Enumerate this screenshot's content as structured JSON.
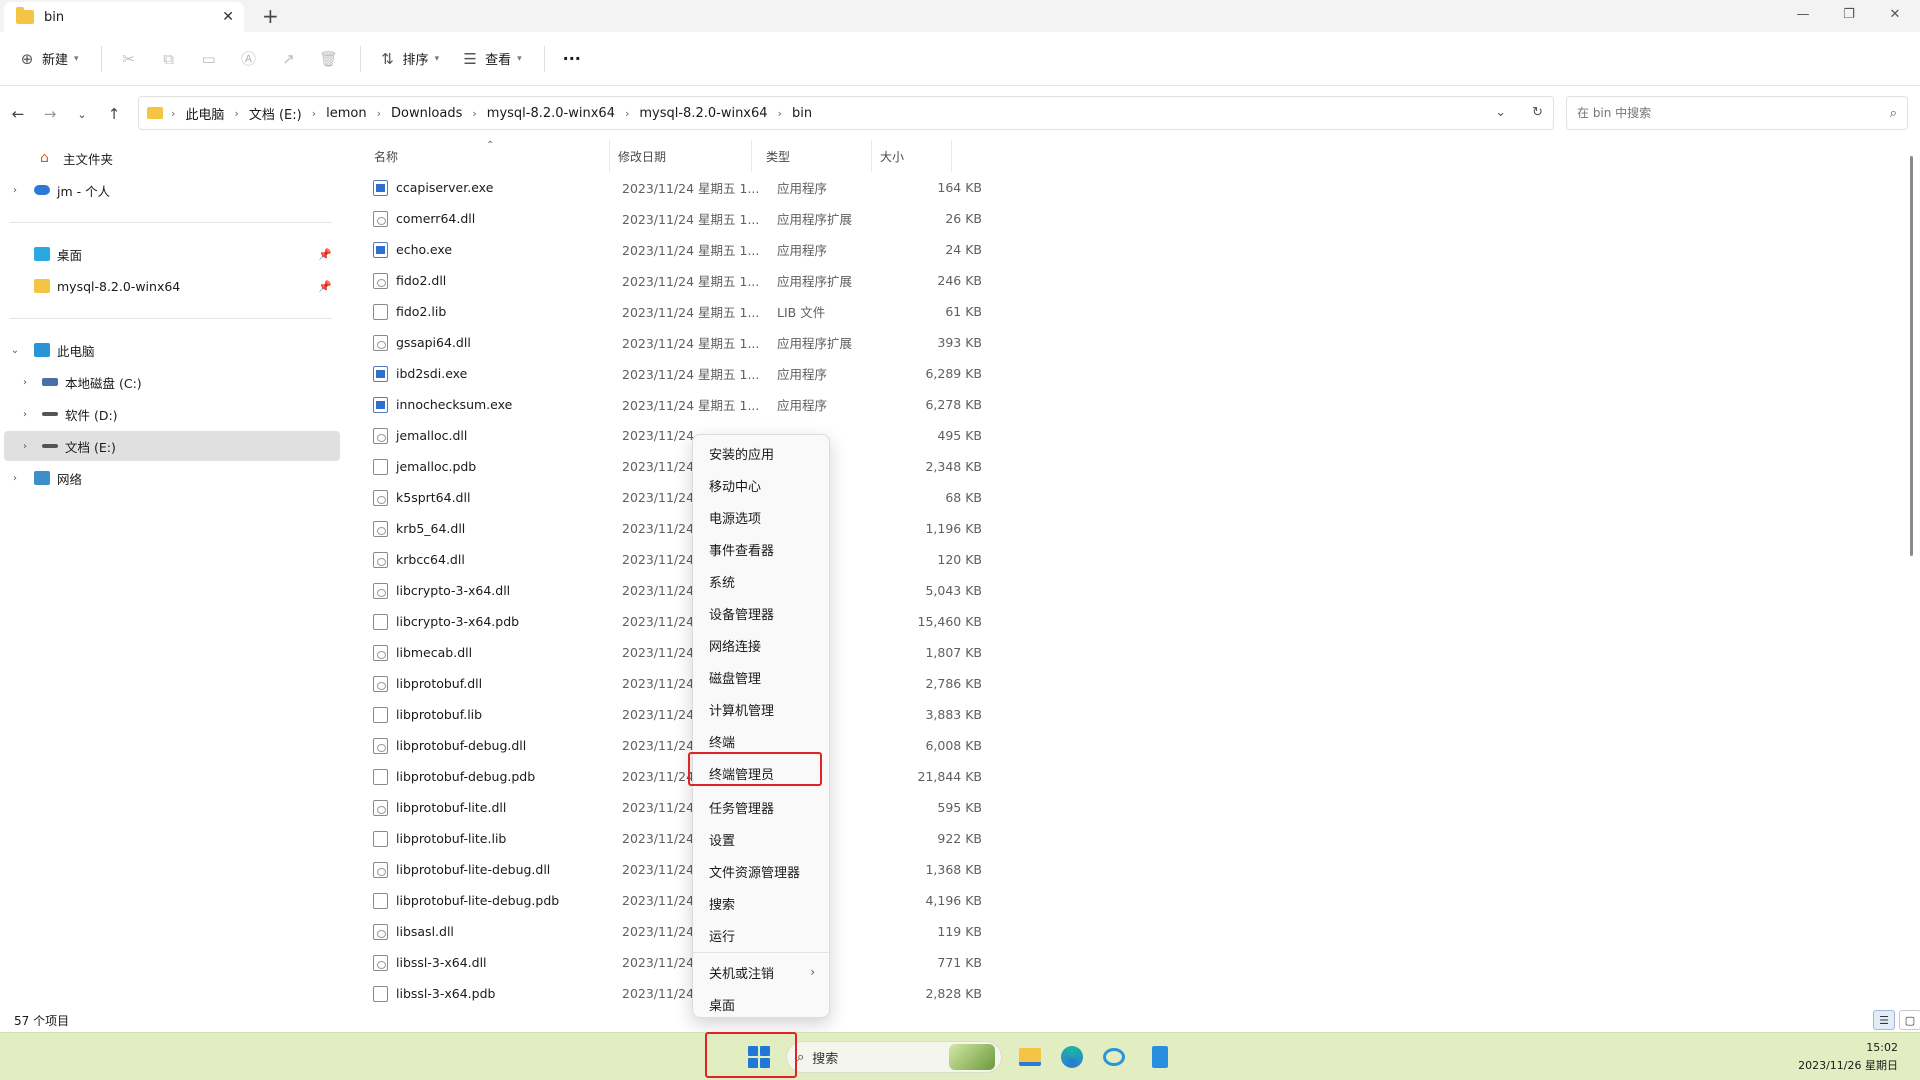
{
  "window": {
    "tab_title": "bin",
    "new_tab": "+",
    "minimize": "—",
    "restore": "❐",
    "close": "✕"
  },
  "toolbar": {
    "new_label": "新建",
    "sort_label": "排序",
    "view_label": "查看",
    "more_label": "···"
  },
  "address": {
    "crumbs": [
      "此电脑",
      "文档 (E:)",
      "lemon",
      "Downloads",
      "mysql-8.2.0-winx64",
      "mysql-8.2.0-winx64",
      "bin"
    ]
  },
  "search": {
    "placeholder": "在 bin 中搜索"
  },
  "sidebar": {
    "home": "主文件夹",
    "cloud": "jm - 个人",
    "desktop": "桌面",
    "mysql": "mysql-8.2.0-winx64",
    "pc": "此电脑",
    "drive_c": "本地磁盘 (C:)",
    "drive_d": "软件 (D:)",
    "drive_e": "文档 (E:)",
    "network": "网络"
  },
  "columns": {
    "name": "名称",
    "date": "修改日期",
    "type": "类型",
    "size": "大小"
  },
  "files": [
    {
      "name": "ccapiserver.exe",
      "date": "2023/11/24 星期五 1...",
      "type": "应用程序",
      "size": "164 KB",
      "kind": "exe"
    },
    {
      "name": "comerr64.dll",
      "date": "2023/11/24 星期五 1...",
      "type": "应用程序扩展",
      "size": "26 KB",
      "kind": "dll"
    },
    {
      "name": "echo.exe",
      "date": "2023/11/24 星期五 1...",
      "type": "应用程序",
      "size": "24 KB",
      "kind": "exe"
    },
    {
      "name": "fido2.dll",
      "date": "2023/11/24 星期五 1...",
      "type": "应用程序扩展",
      "size": "246 KB",
      "kind": "dll"
    },
    {
      "name": "fido2.lib",
      "date": "2023/11/24 星期五 1...",
      "type": "LIB 文件",
      "size": "61 KB",
      "kind": "file"
    },
    {
      "name": "gssapi64.dll",
      "date": "2023/11/24 星期五 1...",
      "type": "应用程序扩展",
      "size": "393 KB",
      "kind": "dll"
    },
    {
      "name": "ibd2sdi.exe",
      "date": "2023/11/24 星期五 1...",
      "type": "应用程序",
      "size": "6,289 KB",
      "kind": "exe"
    },
    {
      "name": "innochecksum.exe",
      "date": "2023/11/24 星期五 1...",
      "type": "应用程序",
      "size": "6,278 KB",
      "kind": "exe"
    },
    {
      "name": "jemalloc.dll",
      "date": "2023/11/24",
      "type": "",
      "size": "495 KB",
      "kind": "dll"
    },
    {
      "name": "jemalloc.pdb",
      "date": "2023/11/24",
      "type": "",
      "size": "2,348 KB",
      "kind": "file"
    },
    {
      "name": "k5sprt64.dll",
      "date": "2023/11/24",
      "type": "展",
      "size": "68 KB",
      "kind": "dll"
    },
    {
      "name": "krb5_64.dll",
      "date": "2023/11/24",
      "type": "展",
      "size": "1,196 KB",
      "kind": "dll"
    },
    {
      "name": "krbcc64.dll",
      "date": "2023/11/24",
      "type": "展",
      "size": "120 KB",
      "kind": "dll"
    },
    {
      "name": "libcrypto-3-x64.dll",
      "date": "2023/11/24",
      "type": "展",
      "size": "5,043 KB",
      "kind": "dll"
    },
    {
      "name": "libcrypto-3-x64.pdb",
      "date": "2023/11/24",
      "type": "",
      "size": "15,460 KB",
      "kind": "file"
    },
    {
      "name": "libmecab.dll",
      "date": "2023/11/24",
      "type": "",
      "size": "1,807 KB",
      "kind": "dll"
    },
    {
      "name": "libprotobuf.dll",
      "date": "2023/11/24",
      "type": "展",
      "size": "2,786 KB",
      "kind": "dll"
    },
    {
      "name": "libprotobuf.lib",
      "date": "2023/11/24",
      "type": "",
      "size": "3,883 KB",
      "kind": "file"
    },
    {
      "name": "libprotobuf-debug.dll",
      "date": "2023/11/24",
      "type": "展",
      "size": "6,008 KB",
      "kind": "dll"
    },
    {
      "name": "libprotobuf-debug.pdb",
      "date": "2023/11/24",
      "type": "",
      "size": "21,844 KB",
      "kind": "file"
    },
    {
      "name": "libprotobuf-lite.dll",
      "date": "2023/11/24",
      "type": "展",
      "size": "595 KB",
      "kind": "dll"
    },
    {
      "name": "libprotobuf-lite.lib",
      "date": "2023/11/24",
      "type": "",
      "size": "922 KB",
      "kind": "file"
    },
    {
      "name": "libprotobuf-lite-debug.dll",
      "date": "2023/11/24",
      "type": "展",
      "size": "1,368 KB",
      "kind": "dll"
    },
    {
      "name": "libprotobuf-lite-debug.pdb",
      "date": "2023/11/24",
      "type": "",
      "size": "4,196 KB",
      "kind": "file"
    },
    {
      "name": "libsasl.dll",
      "date": "2023/11/24",
      "type": "展",
      "size": "119 KB",
      "kind": "dll"
    },
    {
      "name": "libssl-3-x64.dll",
      "date": "2023/11/24",
      "type": "展",
      "size": "771 KB",
      "kind": "dll"
    },
    {
      "name": "libssl-3-x64.pdb",
      "date": "2023/11/24",
      "type": "",
      "size": "2,828 KB",
      "kind": "file"
    }
  ],
  "status": {
    "count": "57 个项目"
  },
  "context_menu": {
    "items": [
      "安装的应用",
      "移动中心",
      "电源选项",
      "事件查看器",
      "系统",
      "设备管理器",
      "网络连接",
      "磁盘管理",
      "计算机管理",
      "终端",
      "终端管理员",
      "任务管理器",
      "设置",
      "文件资源管理器",
      "搜索",
      "运行",
      "关机或注销",
      "桌面"
    ],
    "highlighted": "终端管理员"
  },
  "taskbar": {
    "search_label": "搜索",
    "time": "15:02",
    "date": "2023/11/26 星期日"
  },
  "colors": {
    "accent": "#1f78d7",
    "highlight": "#e02424",
    "taskbar": "#e3edc2",
    "folder": "#f6c445"
  }
}
